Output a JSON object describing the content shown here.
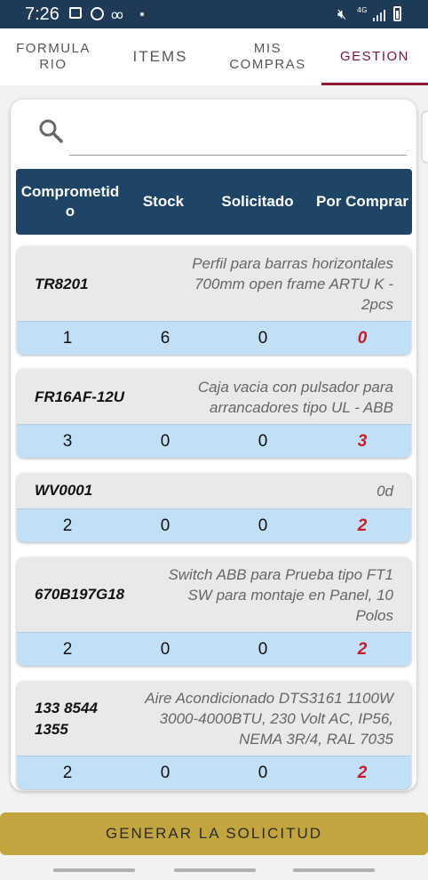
{
  "status_bar": {
    "time": "7:26",
    "network": "4G",
    "icons": [
      "gallery-icon",
      "person-icon",
      "voicemail-icon",
      "mute-icon",
      "signal-icon",
      "battery-icon"
    ]
  },
  "tabs": [
    {
      "label": "FORMULA\nRIO",
      "active": false
    },
    {
      "label": "ITEMS",
      "active": false
    },
    {
      "label": "MIS\nCOMPRAS",
      "active": false
    },
    {
      "label": "GESTION",
      "active": true
    }
  ],
  "search": {
    "placeholder": "",
    "value": ""
  },
  "table": {
    "headers": [
      "Comprometid\no",
      "Stock",
      "Solicitado",
      "Por Comprar"
    ],
    "items": [
      {
        "code": "TR8201",
        "description": "Perfil para barras horizontales 700mm open frame ARTU K - 2pcs",
        "comprometido": "1",
        "stock": "6",
        "solicitado": "0",
        "por_comprar": "0"
      },
      {
        "code": "FR16AF-12U",
        "description": "Caja vacia con pulsador para arrancadores tipo UL - ABB",
        "comprometido": "3",
        "stock": "0",
        "solicitado": "0",
        "por_comprar": "3"
      },
      {
        "code": "WV0001",
        "description": "0d",
        "comprometido": "2",
        "stock": "0",
        "solicitado": "0",
        "por_comprar": "2"
      },
      {
        "code": "670B197G18",
        "description": "Switch ABB para Prueba tipo FT1 SW para montaje en Panel, 10 Polos",
        "comprometido": "2",
        "stock": "0",
        "solicitado": "0",
        "por_comprar": "2"
      },
      {
        "code": "133 8544 1355",
        "description": "Aire Acondicionado DTS3161 1100W 3000-4000BTU, 230 Volt AC, IP56, NEMA 3R/4, RAL 7035",
        "comprometido": "2",
        "stock": "0",
        "solicitado": "0",
        "por_comprar": "2"
      }
    ]
  },
  "actions": {
    "generate_label": "GENERAR LA SOLICITUD"
  },
  "colors": {
    "status_bar": "#1e3a57",
    "header_bg": "#1e4466",
    "active_tab": "#8b1a34",
    "row_numbers_bg": "#c2dff8",
    "por_comprar_text": "#c81d25",
    "button_bg": "#c3a53f"
  }
}
